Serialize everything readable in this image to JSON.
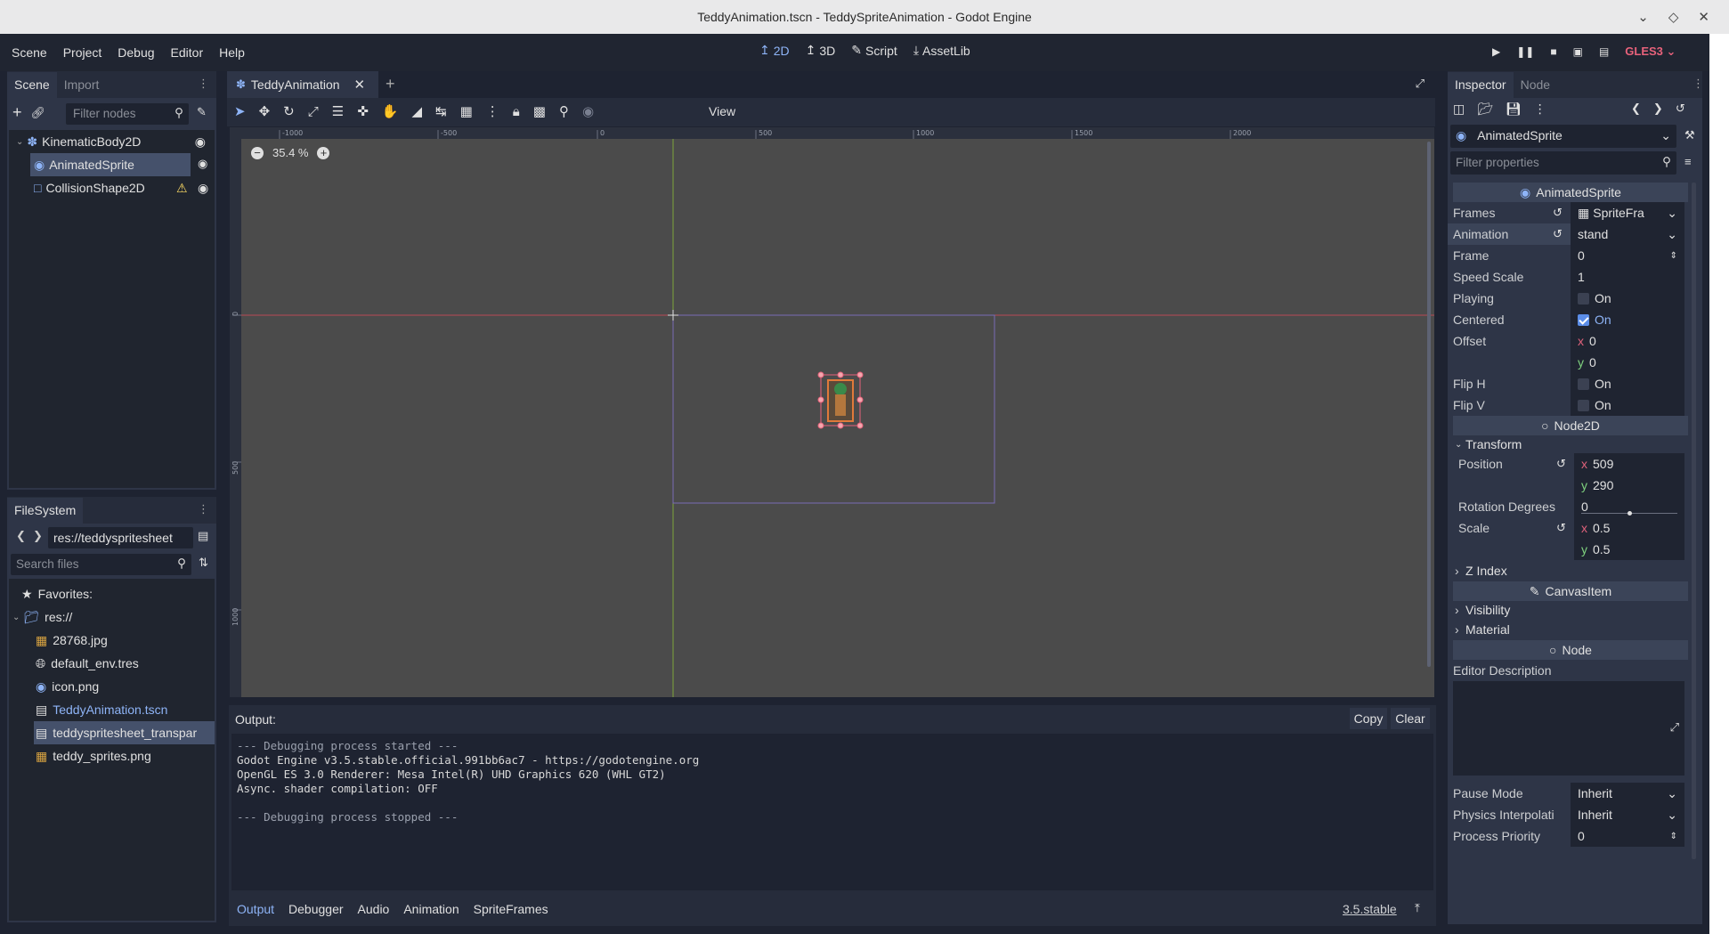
{
  "window": {
    "title": "TeddyAnimation.tscn - TeddySpriteAnimation - Godot Engine"
  },
  "menubar": {
    "menus": [
      "Scene",
      "Project",
      "Debug",
      "Editor",
      "Help"
    ],
    "modes": [
      "2D",
      "3D",
      "Script",
      "AssetLib"
    ],
    "renderer": "GLES3"
  },
  "scene_panel": {
    "tabs": [
      "Scene",
      "Import"
    ],
    "filter_placeholder": "Filter nodes",
    "nodes": [
      {
        "label": "KinematicBody2D"
      },
      {
        "label": "AnimatedSprite"
      },
      {
        "label": "CollisionShape2D"
      }
    ]
  },
  "filesystem": {
    "tab": "FileSystem",
    "path": "res://teddyspritesheet",
    "search_placeholder": "Search files",
    "favorites": "Favorites:",
    "root": "res://",
    "files": [
      "28768.jpg",
      "default_env.tres",
      "icon.png",
      "TeddyAnimation.tscn",
      "teddyspritesheet_transpar",
      "teddy_sprites.png"
    ]
  },
  "viewport": {
    "scene_tab": "TeddyAnimation",
    "view_menu": "View",
    "zoom": "35.4 %",
    "ruler_labels": [
      "-1000",
      "-500",
      "0",
      "500",
      "1000",
      "1500",
      "2000"
    ],
    "vruler_labels": [
      "0",
      "500",
      "1000"
    ]
  },
  "output": {
    "label": "Output:",
    "copy": "Copy",
    "clear": "Clear",
    "lines": [
      "--- Debugging process started ---",
      "Godot Engine v3.5.stable.official.991bb6ac7 - https://godotengine.org",
      "OpenGL ES 3.0 Renderer: Mesa Intel(R) UHD Graphics 620 (WHL GT2)",
      "Async. shader compilation: OFF",
      "",
      "--- Debugging process stopped ---"
    ]
  },
  "bottom_tabs": [
    "Output",
    "Debugger",
    "Audio",
    "Animation",
    "SpriteFrames"
  ],
  "version": "3.5.stable",
  "inspector": {
    "tabs": [
      "Inspector",
      "Node"
    ],
    "node_name": "AnimatedSprite",
    "filter_placeholder": "Filter properties",
    "class_header": "AnimatedSprite",
    "props": {
      "frames_label": "Frames",
      "frames_value": "SpriteFra",
      "animation_label": "Animation",
      "animation_value": "stand",
      "frame_label": "Frame",
      "frame_value": "0",
      "speed_label": "Speed Scale",
      "speed_value": "1",
      "playing_label": "Playing",
      "playing_value": "On",
      "centered_label": "Centered",
      "centered_value": "On",
      "offset_label": "Offset",
      "offset_x": "0",
      "offset_y": "0",
      "fliph_label": "Flip H",
      "fliph_value": "On",
      "flipv_label": "Flip V",
      "flipv_value": "On"
    },
    "node2d_header": "Node2D",
    "transform_label": "Transform",
    "transform": {
      "position_label": "Position",
      "pos_x": "509",
      "pos_y": "290",
      "rotation_label": "Rotation Degrees",
      "rotation_value": "0",
      "scale_label": "Scale",
      "scale_x": "0.5",
      "scale_y": "0.5"
    },
    "zindex_label": "Z Index",
    "canvasitem_header": "CanvasItem",
    "visibility_label": "Visibility",
    "material_label": "Material",
    "node_header": "Node",
    "editor_description_label": "Editor Description",
    "pause_mode_label": "Pause Mode",
    "pause_mode_value": "Inherit",
    "physics_label": "Physics Interpolati",
    "physics_value": "Inherit",
    "priority_label": "Process Priority",
    "priority_value": "0",
    "axis_x": "x",
    "axis_y": "y"
  },
  "colors": {
    "accent": "#8eb4f7",
    "warning": "#ffdd65",
    "x_axis": "#e0627b",
    "y_axis": "#7fd27f"
  }
}
